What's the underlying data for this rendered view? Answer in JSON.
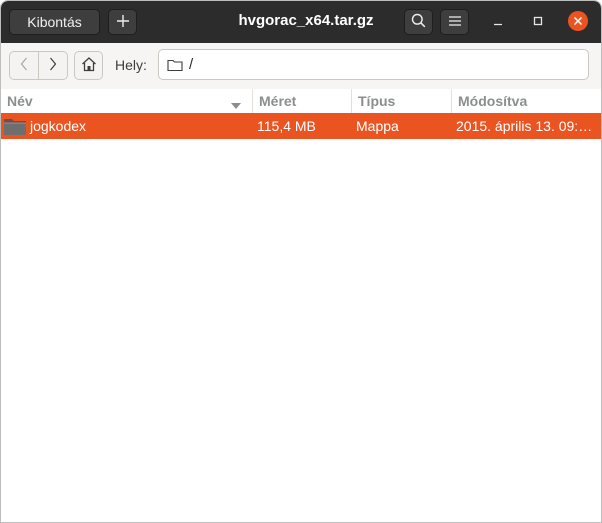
{
  "header": {
    "extract_label": "Kibontás",
    "add_icon": "plus-icon",
    "title": "hvgorac_x64.tar.gz",
    "search_icon": "search-icon",
    "menu_icon": "hamburger-menu-icon",
    "minimize_icon": "minimize-icon",
    "maximize_icon": "maximize-icon",
    "close_icon": "close-icon"
  },
  "location": {
    "back_icon": "chevron-left-icon",
    "forward_icon": "chevron-right-icon",
    "home_icon": "home-icon",
    "label": "Hely:",
    "path": "/"
  },
  "columns": {
    "name": "Név",
    "size": "Méret",
    "type": "Típus",
    "modified": "Módosítva"
  },
  "files": [
    {
      "name": "jogkodex",
      "size": "115,4 MB",
      "type": "Mappa",
      "modified": "2015. április 13. 09:…",
      "selected": true
    }
  ],
  "colors": {
    "accent": "#e95420",
    "headerbar": "#2c2c2c"
  }
}
